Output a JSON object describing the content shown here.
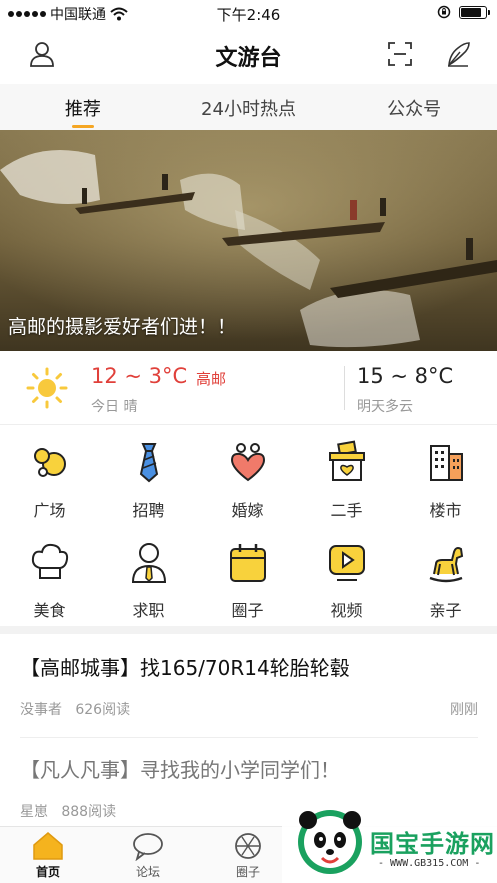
{
  "status_bar": {
    "carrier": "中国联通",
    "time": "下午2:46",
    "battery_level": 0.85
  },
  "nav": {
    "title": "文游台",
    "left_icon": "user-icon",
    "right_icons": [
      "scan-icon",
      "pen-icon"
    ]
  },
  "tabs": [
    {
      "label": "推荐",
      "active": true
    },
    {
      "label": "24小时热点",
      "active": false
    },
    {
      "label": "公众号",
      "active": false
    }
  ],
  "banner": {
    "caption": "高邮的摄影爱好者们进！！"
  },
  "weather": {
    "today_temp": "12 ~ 3°C",
    "city": "高邮",
    "today_desc": "今日 晴",
    "tomorrow_temp": "15 ~ 8°C",
    "tomorrow_desc": "明天多云",
    "accent": "#e0403a"
  },
  "grid": [
    {
      "label": "广场",
      "icon": "bubbles-icon"
    },
    {
      "label": "招聘",
      "icon": "tie-icon"
    },
    {
      "label": "婚嫁",
      "icon": "heart-person-icon"
    },
    {
      "label": "二手",
      "icon": "basket-icon"
    },
    {
      "label": "楼市",
      "icon": "building-icon"
    },
    {
      "label": "美食",
      "icon": "chef-hat-icon"
    },
    {
      "label": "求职",
      "icon": "worker-icon"
    },
    {
      "label": "圈子",
      "icon": "calendar-icon"
    },
    {
      "label": "视频",
      "icon": "video-play-icon"
    },
    {
      "label": "亲子",
      "icon": "rocking-horse-icon"
    }
  ],
  "news": [
    {
      "title": "【高邮城事】找165/70R14轮胎轮毂",
      "author": "没事者",
      "reads": "626阅读",
      "time": "刚刚"
    },
    {
      "title": "【凡人凡事】寻找我的小学同学们！",
      "author": "星崽",
      "reads": "888阅读",
      "time": ""
    }
  ],
  "tab_bar": [
    {
      "label": "首页",
      "icon": "home-icon",
      "active": true
    },
    {
      "label": "论坛",
      "icon": "chat-icon",
      "active": false
    },
    {
      "label": "圈子",
      "icon": "aperture-icon",
      "active": false
    }
  ],
  "watermark": {
    "text": "国宝手游网",
    "url": "- WWW.GB315.COM -"
  },
  "colors": {
    "brand_yellow": "#f8d23c",
    "tab_underline": "#f5a623",
    "watermark_green": "#1aa15f"
  }
}
